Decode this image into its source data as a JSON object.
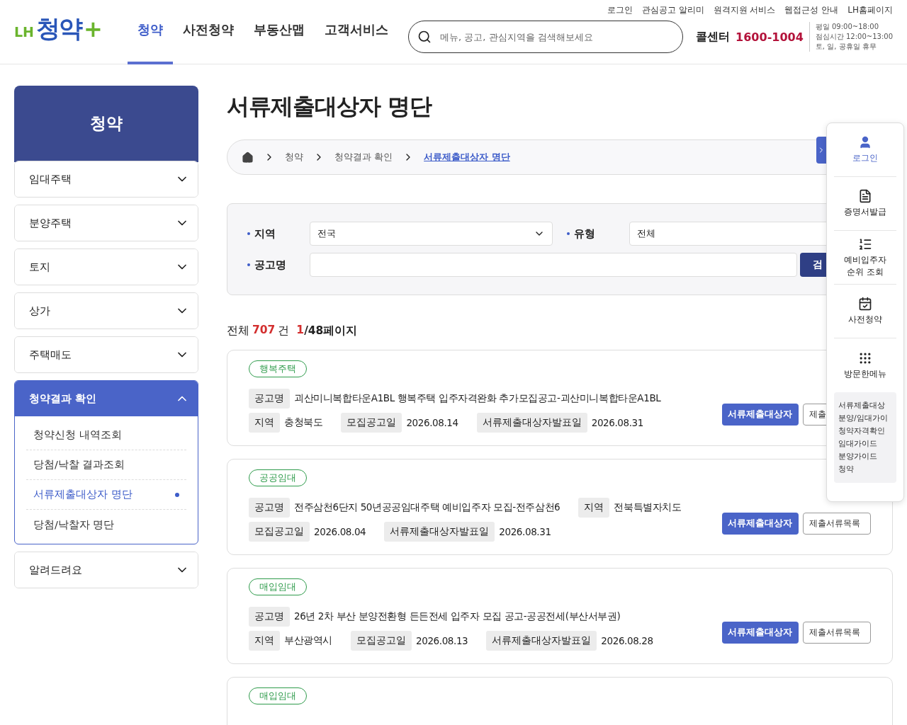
{
  "header": {
    "logo": {
      "prefix": "LH",
      "name": "청약",
      "plus": "+"
    },
    "nav": [
      {
        "label": "청약",
        "selected": true
      },
      {
        "label": "사전청약",
        "selected": false
      },
      {
        "label": "부동산맵",
        "selected": false
      },
      {
        "label": "고객서비스",
        "selected": false
      }
    ],
    "utility_links": [
      "로그인",
      "관심공고 알리미",
      "원격지원 서비스",
      "웹접근성 안내",
      "LH홈페이지"
    ],
    "search": {
      "placeholder": "메뉴, 공고, 관심지역을 검색해보세요"
    },
    "call_center": {
      "label": "콜센터",
      "number": "1600-1004",
      "hours": [
        "평일 09:00~18:00",
        "점심시간 12:00~13:00",
        "토, 일, 공휴일 휴무"
      ]
    }
  },
  "sidebar": {
    "title": "청약",
    "items": [
      {
        "label": "임대주택",
        "expanded": false
      },
      {
        "label": "분양주택",
        "expanded": false
      },
      {
        "label": "토지",
        "expanded": false
      },
      {
        "label": "상가",
        "expanded": false
      },
      {
        "label": "주택매도",
        "expanded": false
      },
      {
        "label": "청약결과 확인",
        "expanded": true,
        "children": [
          {
            "label": "청약신청 내역조회",
            "selected": false
          },
          {
            "label": "당첨/낙찰 결과조회",
            "selected": false
          },
          {
            "label": "서류제출대상자 명단",
            "selected": true
          },
          {
            "label": "당첨/낙찰자 명단",
            "selected": false
          }
        ]
      },
      {
        "label": "알려드려요",
        "expanded": false
      }
    ]
  },
  "page_title": "서류제출대상자 명단",
  "breadcrumb": [
    "청약",
    "청약결과 확인",
    "서류제출대상자 명단"
  ],
  "filters": {
    "region": {
      "label": "지역",
      "value": "전국"
    },
    "type": {
      "label": "유형",
      "value": "전체"
    },
    "notice": {
      "label": "공고명"
    },
    "search_button": "검"
  },
  "count": {
    "prefix": "전체",
    "total": "707",
    "unit": "건",
    "page": "1",
    "pages": "/48페이지"
  },
  "cards": [
    {
      "category": "행복주택",
      "lines": [
        {
          "items": [
            {
              "label": "공고명",
              "value": "괴산미니복합타운A1BL 행복주택 입주자격완화 추가모집공고-괴산미니복합타운A1BL"
            }
          ]
        },
        {
          "items": [
            {
              "label": "지역",
              "value": "충청북도"
            },
            {
              "label": "모집공고일",
              "value": "2026.08.14"
            },
            {
              "label": "서류제출대상자발표일",
              "value": "2026.08.31"
            }
          ]
        }
      ],
      "buttons": [
        {
          "label": "서류제출대상자",
          "kind": "primary"
        },
        {
          "label": "제출",
          "kind": "outline"
        }
      ]
    },
    {
      "category": "공공임대",
      "lines": [
        {
          "items": [
            {
              "label": "공고명",
              "value": "전주삼천6단지 50년공공임대주택 예비입주자 모집-전주삼천6"
            },
            {
              "label": "지역",
              "value": "전북특별자치도"
            }
          ]
        },
        {
          "items": [
            {
              "label": "모집공고일",
              "value": "2026.08.04"
            },
            {
              "label": "서류제출대상자발표일",
              "value": "2026.08.31"
            }
          ]
        }
      ],
      "buttons": [
        {
          "label": "서류제출대상자",
          "kind": "primary"
        },
        {
          "label": "제출서류목록",
          "kind": "outline"
        }
      ]
    },
    {
      "category": "매입임대",
      "lines": [
        {
          "items": [
            {
              "label": "공고명",
              "value": "26년 2차 부산 분양전환형 든든전세 입주자 모집 공고-공공전세(부산서부권)"
            }
          ]
        },
        {
          "items": [
            {
              "label": "지역",
              "value": "부산광역시"
            },
            {
              "label": "모집공고일",
              "value": "2026.08.13"
            },
            {
              "label": "서류제출대상자발표일",
              "value": "2026.08.28"
            }
          ]
        }
      ],
      "buttons": [
        {
          "label": "서류제출대상자",
          "kind": "primary"
        },
        {
          "label": "제출서류목록",
          "kind": "outline"
        }
      ]
    },
    {
      "category": "매입임대"
    }
  ],
  "quick_menu": {
    "items": [
      {
        "label": "로그인",
        "active": true
      },
      {
        "label": "증명서발급",
        "active": false
      },
      {
        "label": "예비입주자\n순위 조회",
        "active": false
      },
      {
        "label": "사전청약",
        "active": false
      },
      {
        "label": "방문한메뉴",
        "active": false
      }
    ],
    "recent": [
      "서류제출대상",
      "분양/임대가이",
      "청약자격확인",
      "임대가이드",
      "분양가이드",
      "청약"
    ]
  }
}
